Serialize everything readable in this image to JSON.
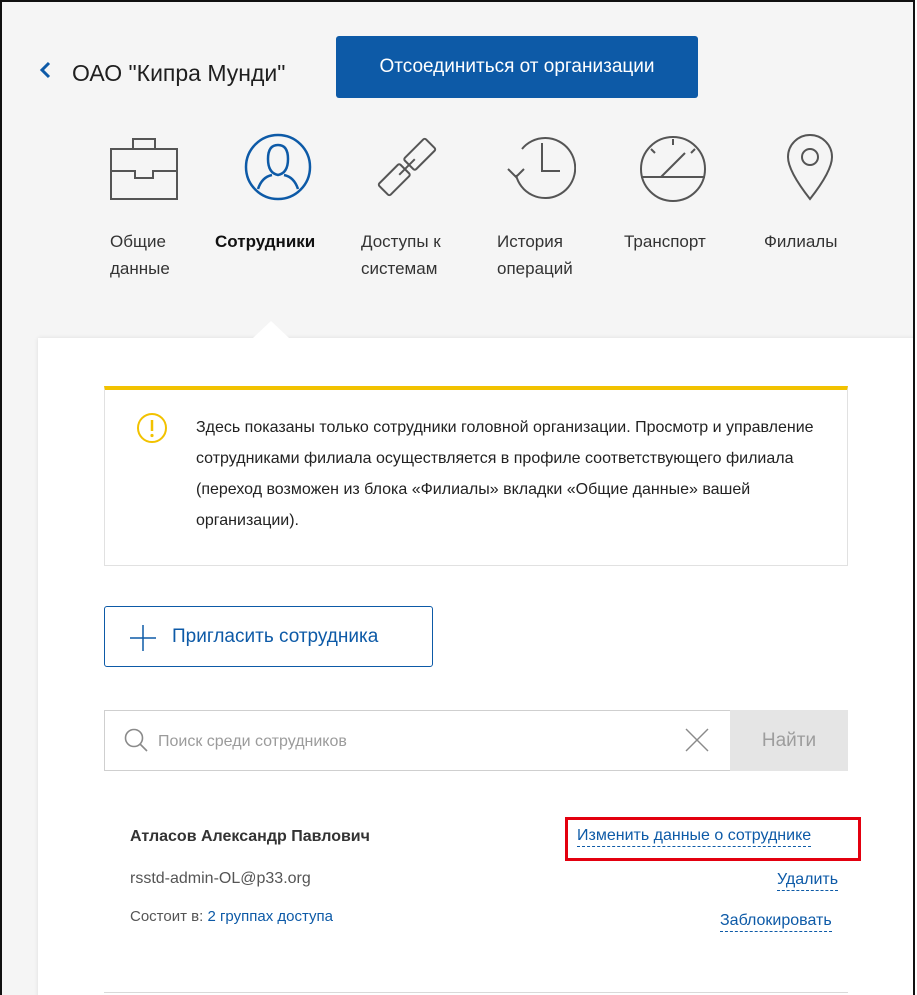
{
  "header": {
    "org_name": "ОАО \"Кипра Мунди\"",
    "detach_button": "Отсоединиться от организации",
    "back_icon": "chevron-left-icon"
  },
  "tabs": [
    {
      "label": "Общие\nданные",
      "icon": "briefcase-icon",
      "active": false
    },
    {
      "label": "Сотрудники",
      "icon": "person-icon",
      "active": true
    },
    {
      "label": "Доступы к\nсистемам",
      "icon": "chain-link-icon",
      "active": false
    },
    {
      "label": "История\nопераций",
      "icon": "history-icon",
      "active": false
    },
    {
      "label": "Транспорт",
      "icon": "speedometer-icon",
      "active": false
    },
    {
      "label": "Филиалы",
      "icon": "location-pin-icon",
      "active": false
    }
  ],
  "notice": {
    "text": "Здесь показаны только сотрудники головной организации. Просмотр и управление сотрудниками филиала осуществляется в профиле соответствующего филиала (переход возможен из блока «Филиалы» вкладки «Общие данные» вашей организации).",
    "icon": "warning-icon"
  },
  "invite_button": "Пригласить сотрудника",
  "search": {
    "placeholder": "Поиск среди сотрудников",
    "value": "",
    "find_button": "Найти"
  },
  "employee": {
    "name": "Атласов Александр Павлович",
    "email": "rsstd-admin-OL@p33.org",
    "groups_prefix": "Состоит в:",
    "groups_link": "2 группах доступа",
    "edit_link": "Изменить данные о сотруднике",
    "delete_link": "Удалить",
    "block_link": "Заблокировать"
  },
  "colors": {
    "primary": "#0d5aa7",
    "notice_border": "#f2c200",
    "highlight": "#e3000f"
  }
}
